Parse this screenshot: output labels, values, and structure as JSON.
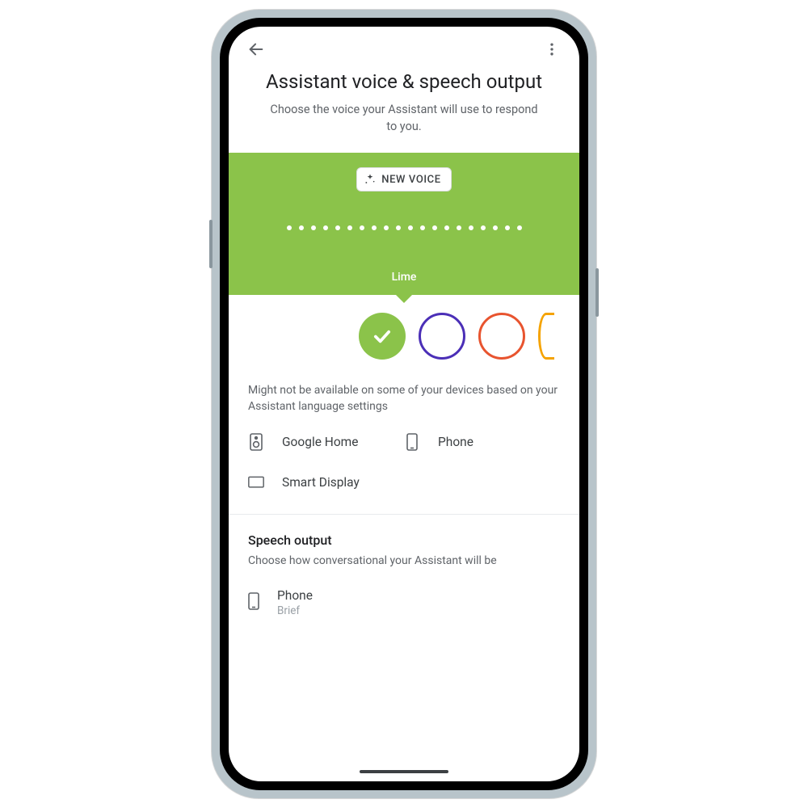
{
  "colors": {
    "lime": "#8bc34a",
    "purple": "#4b2fb7",
    "orange_red": "#e8542f",
    "golden": "#f5a300"
  },
  "header": {
    "title": "Assistant voice & speech output",
    "subtitle": "Choose the voice your Assistant will use to respond to you."
  },
  "voice_panel": {
    "chip_label": "NEW VOICE",
    "dots_count": 20,
    "selected_name": "Lime"
  },
  "swatches": [
    {
      "id": "lime",
      "color": "#8bc34a",
      "selected": true
    },
    {
      "id": "purple",
      "color": "#4b2fb7",
      "selected": false
    },
    {
      "id": "orange-red",
      "color": "#e8542f",
      "selected": false
    },
    {
      "id": "golden",
      "color": "#f5a300",
      "selected": false,
      "partial": true
    }
  ],
  "availability_note": "Might not be available on some of your devices based on your Assistant language settings",
  "devices": [
    {
      "icon": "speaker",
      "label": "Google Home"
    },
    {
      "icon": "phone",
      "label": "Phone"
    },
    {
      "icon": "display",
      "label": "Smart Display"
    }
  ],
  "speech_output": {
    "section_title": "Speech output",
    "section_sub": "Choose how conversational your Assistant will be",
    "items": [
      {
        "icon": "phone",
        "title": "Phone",
        "value": "Brief"
      }
    ]
  }
}
